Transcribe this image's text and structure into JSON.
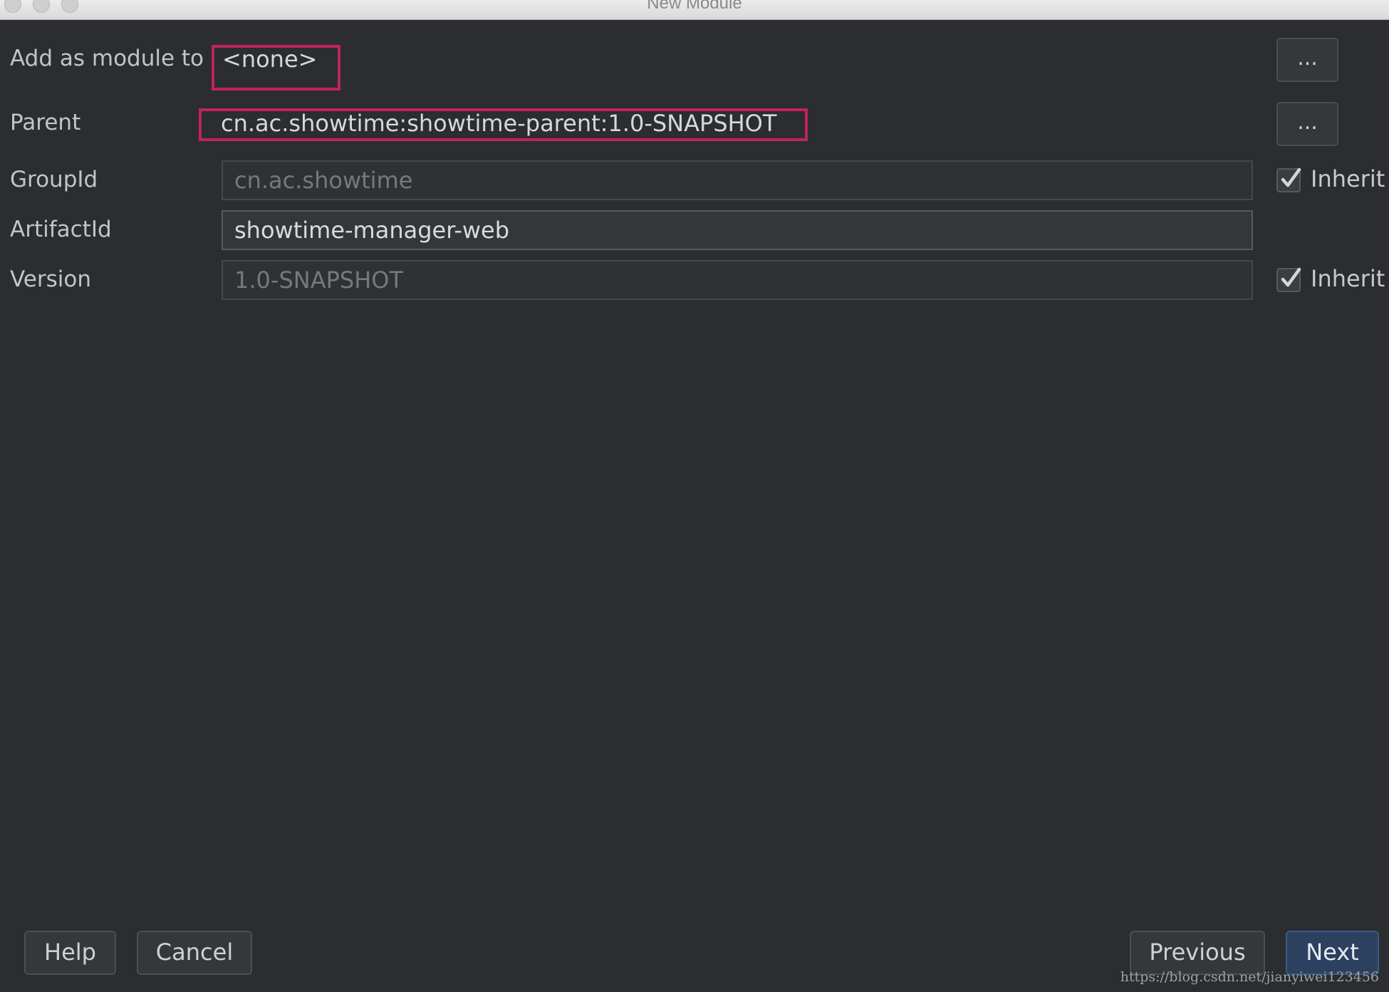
{
  "window": {
    "title": "New Module"
  },
  "form": {
    "add_as_module": {
      "label": "Add as module to",
      "value": "<none>",
      "browse_label": "..."
    },
    "parent": {
      "label": "Parent",
      "value": "cn.ac.showtime:showtime-parent:1.0-SNAPSHOT",
      "browse_label": "..."
    },
    "group_id": {
      "label": "GroupId",
      "value": "cn.ac.showtime",
      "inherit_label": "Inherit",
      "inherit_checked": true
    },
    "artifact_id": {
      "label": "ArtifactId",
      "value": "showtime-manager-web"
    },
    "version": {
      "label": "Version",
      "value": "1.0-SNAPSHOT",
      "inherit_label": "Inherit",
      "inherit_checked": true
    }
  },
  "footer": {
    "help_label": "Help",
    "cancel_label": "Cancel",
    "previous_label": "Previous",
    "next_label": "Next"
  },
  "watermark": "https://blog.csdn.net/jianyiwei123456",
  "colors": {
    "background": "#2b2d30",
    "highlight": "#c0245a",
    "primary_button": "#2c4060"
  }
}
